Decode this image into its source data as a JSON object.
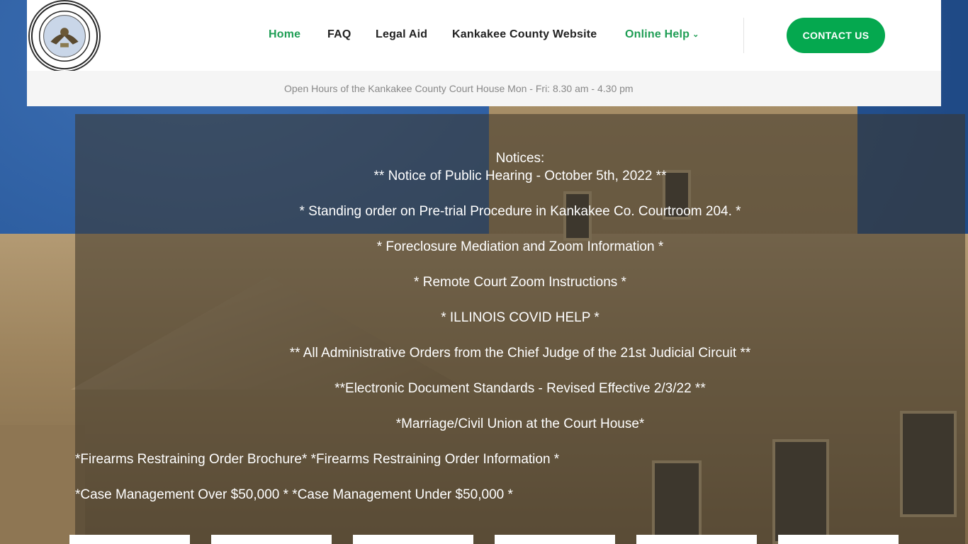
{
  "header": {
    "logo_alt": "Clerk of the Twenty-First Judicial Circuit seal",
    "nav": [
      {
        "label": "Home"
      },
      {
        "label": "FAQ"
      },
      {
        "label": "Legal Aid"
      },
      {
        "label": "Kankakee County Website"
      },
      {
        "label": "Online Help"
      }
    ],
    "contact_label": "CONTACT US"
  },
  "hours_bar": {
    "text": "Open Hours of the Kankakee County Court House Mon - Fri: 8.30 am - 4.30 pm"
  },
  "notices": {
    "heading": "Notices:",
    "items": [
      "** Notice of Public Hearing - October 5th, 2022 **",
      "* Standing order on Pre-trial Procedure in Kankakee Co. Courtroom 204. *",
      "* Foreclosure Mediation and Zoom Information *",
      "* Remote Court Zoom Instructions *",
      "* ILLINOIS COVID HELP *",
      "** All Administrative Orders from the Chief Judge of the 21st Judicial Circuit **",
      "**Electronic Document Standards - Revised Effective 2/3/22 **",
      "*Marriage/Civil Union at the Court House*"
    ],
    "pairs": [
      [
        "*Firearms Restraining Order Brochure*",
        "*Firearms Restraining Order Information *"
      ],
      [
        "*Case Management Over $50,000 *",
        "*Case Management Under $50,000 *"
      ]
    ]
  },
  "colors": {
    "accent": "#05a84f",
    "nav_active": "#1f9e55"
  }
}
